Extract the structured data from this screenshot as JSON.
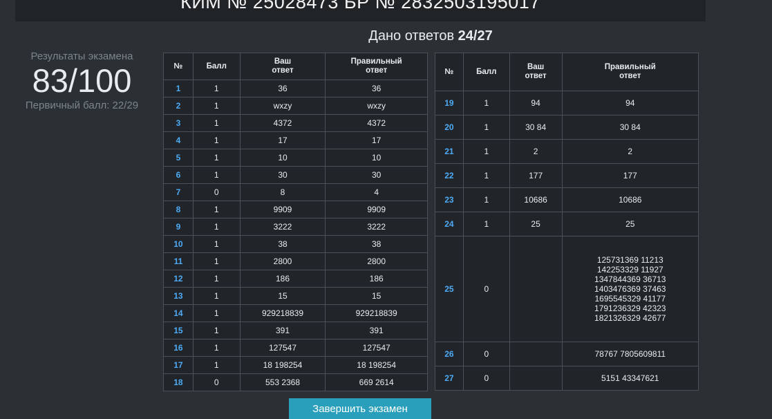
{
  "header": {
    "title": "КИМ № 25028473 БР № 2832503195017"
  },
  "summary": {
    "answered_label": "Дано ответов",
    "answered_value": "24/27"
  },
  "results": {
    "label": "Результаты экзамена",
    "score": "83/100",
    "primary": "Первичный балл: 22/29"
  },
  "table_headers": {
    "num": "№",
    "score": "Балл",
    "yours_1": "Ваш",
    "yours_2": "ответ",
    "correct_1": "Правильный",
    "correct_2": "ответ"
  },
  "rows_left": [
    {
      "n": "1",
      "score": "1",
      "yours": "36",
      "correct": "36"
    },
    {
      "n": "2",
      "score": "1",
      "yours": "wxzy",
      "correct": "wxzy"
    },
    {
      "n": "3",
      "score": "1",
      "yours": "4372",
      "correct": "4372"
    },
    {
      "n": "4",
      "score": "1",
      "yours": "17",
      "correct": "17"
    },
    {
      "n": "5",
      "score": "1",
      "yours": "10",
      "correct": "10"
    },
    {
      "n": "6",
      "score": "1",
      "yours": "30",
      "correct": "30"
    },
    {
      "n": "7",
      "score": "0",
      "yours": "8",
      "correct": "4"
    },
    {
      "n": "8",
      "score": "1",
      "yours": "9909",
      "correct": "9909"
    },
    {
      "n": "9",
      "score": "1",
      "yours": "3222",
      "correct": "3222"
    },
    {
      "n": "10",
      "score": "1",
      "yours": "38",
      "correct": "38"
    },
    {
      "n": "11",
      "score": "1",
      "yours": "2800",
      "correct": "2800"
    },
    {
      "n": "12",
      "score": "1",
      "yours": "186",
      "correct": "186"
    },
    {
      "n": "13",
      "score": "1",
      "yours": "15",
      "correct": "15"
    },
    {
      "n": "14",
      "score": "1",
      "yours": "929218839",
      "correct": "929218839"
    },
    {
      "n": "15",
      "score": "1",
      "yours": "391",
      "correct": "391"
    },
    {
      "n": "16",
      "score": "1",
      "yours": "127547",
      "correct": "127547"
    },
    {
      "n": "17",
      "score": "1",
      "yours": "18 198254",
      "correct": "18 198254"
    },
    {
      "n": "18",
      "score": "0",
      "yours": "553 2368",
      "correct": "669 2614"
    }
  ],
  "rows_right": [
    {
      "n": "19",
      "score": "1",
      "yours": "94",
      "correct": "94"
    },
    {
      "n": "20",
      "score": "1",
      "yours": "30 84",
      "correct": "30 84"
    },
    {
      "n": "21",
      "score": "1",
      "yours": "2",
      "correct": "2"
    },
    {
      "n": "22",
      "score": "1",
      "yours": "177",
      "correct": "177"
    },
    {
      "n": "23",
      "score": "1",
      "yours": "10686",
      "correct": "10686"
    },
    {
      "n": "24",
      "score": "1",
      "yours": "25",
      "correct": "25"
    },
    {
      "n": "25",
      "score": "0",
      "yours": "",
      "correct": "125731369 11213\n142253329 11927\n1347844369 36713\n1403476369 37463\n1695545329 41177\n1791236329 42323\n1821326329 42677"
    },
    {
      "n": "26",
      "score": "0",
      "yours": "",
      "correct": "78767 7805609811"
    },
    {
      "n": "27",
      "score": "0",
      "yours": "",
      "correct": "5151 43347621"
    }
  ],
  "action": {
    "label": "Завершить экзамен"
  }
}
